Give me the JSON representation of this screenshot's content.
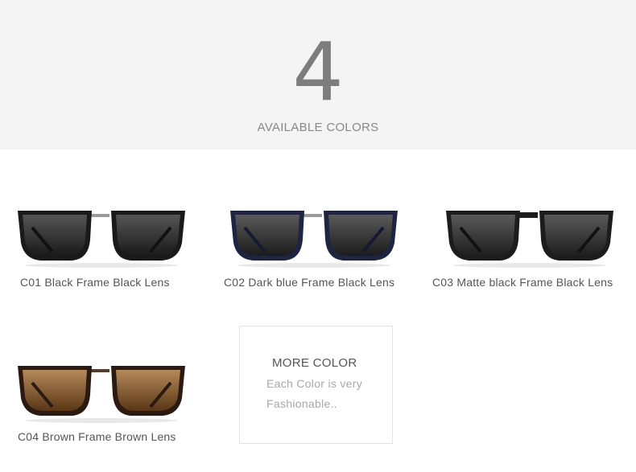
{
  "header": {
    "count": "4",
    "subtitle": "AVAILABLE COLORS"
  },
  "products": [
    {
      "caption": "C01 Black Frame Black Lens",
      "frame_color": "#1a1a1a",
      "lens_color": "#2b2b2b",
      "bridge_color": "#9a9a9a"
    },
    {
      "caption": "C02  Dark blue Frame Black Lens",
      "frame_color": "#1f2440",
      "lens_color": "#2c2c2e",
      "bridge_color": "#9a9a9a"
    },
    {
      "caption": "C03 Matte black Frame Black Lens",
      "frame_color": "#1c1c1c",
      "lens_color": "#2f2f2f",
      "bridge_color": "#2a2a2a"
    },
    {
      "caption": "C04  Brown Frame Brown Lens",
      "frame_color": "#2a1a12",
      "lens_color": "#8a5a2a",
      "bridge_color": "#5a3a2a"
    }
  ],
  "more": {
    "title": "MORE COLOR",
    "line1": "Each Color is very",
    "line2": "Fashionable.."
  }
}
